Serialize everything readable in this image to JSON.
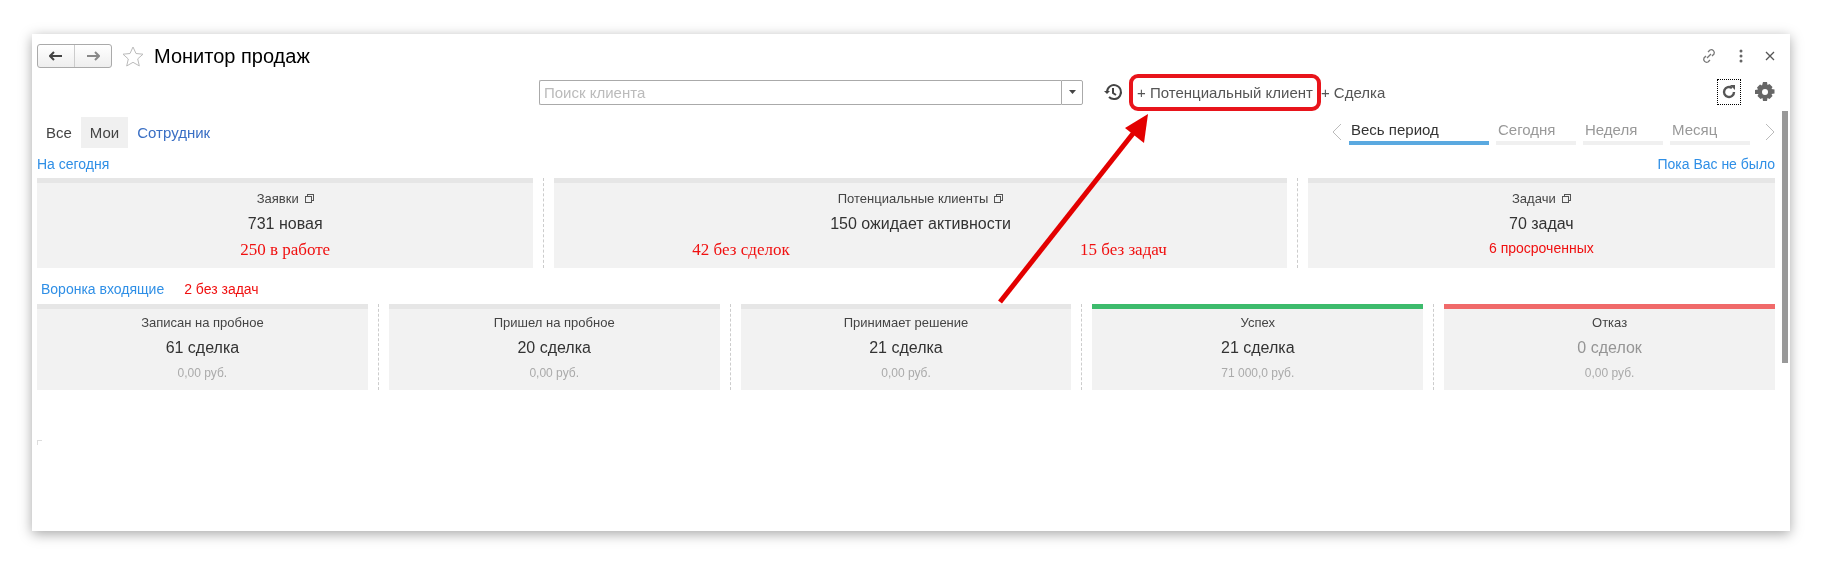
{
  "window": {
    "title": "Монитор продаж"
  },
  "search": {
    "placeholder": "Поиск клиента"
  },
  "actions": [
    {
      "label": "+ Потенциальный клиент",
      "highlighted": true
    },
    {
      "label": "+ Сделка",
      "highlighted": false
    }
  ],
  "filters": [
    {
      "label": "Все",
      "selected": false,
      "kind": "plain"
    },
    {
      "label": "Мои",
      "selected": true,
      "kind": "plain"
    },
    {
      "label": "Сотрудник",
      "selected": false,
      "kind": "link"
    }
  ],
  "periods": [
    {
      "label": "Весь период",
      "selected": true
    },
    {
      "label": "Сегодня",
      "selected": false
    },
    {
      "label": "Неделя",
      "selected": false
    },
    {
      "label": "Месяц",
      "selected": false
    }
  ],
  "today": {
    "heading": "На сегодня",
    "since_link": "Пока Вас не было",
    "cards": [
      {
        "title": "Заявки",
        "main": "731 новая",
        "notes": [
          "250 в работе"
        ]
      },
      {
        "title": "Потенциальные клиенты",
        "main": "150 ожидает активности",
        "notes": [
          "42 без сделок",
          "15 без задач"
        ]
      },
      {
        "title": "Задачи",
        "main": "70 задач",
        "notes": [
          "6 просроченных"
        ]
      }
    ]
  },
  "funnel": {
    "heading": "Воронка входящие",
    "alert": "2 без задач",
    "stages": [
      {
        "title": "Записан на пробное",
        "main": "61 сделка",
        "amount": "0,00 руб.",
        "color": "#e6e6e6",
        "faded": false
      },
      {
        "title": "Пришел на пробное",
        "main": "20 сделка",
        "amount": "0,00 руб.",
        "color": "#e6e6e6",
        "faded": false
      },
      {
        "title": "Принимает решение",
        "main": "21 сделка",
        "amount": "0,00 руб.",
        "color": "#e6e6e6",
        "faded": false
      },
      {
        "title": "Успех",
        "main": "21 сделка",
        "amount": "71 000,0 руб.",
        "color": "#3dbb6c",
        "faded": false
      },
      {
        "title": "Отказ",
        "main": "0 сделок",
        "amount": "0,00 руб.",
        "color": "#f06a6a",
        "faded": true
      }
    ]
  }
}
